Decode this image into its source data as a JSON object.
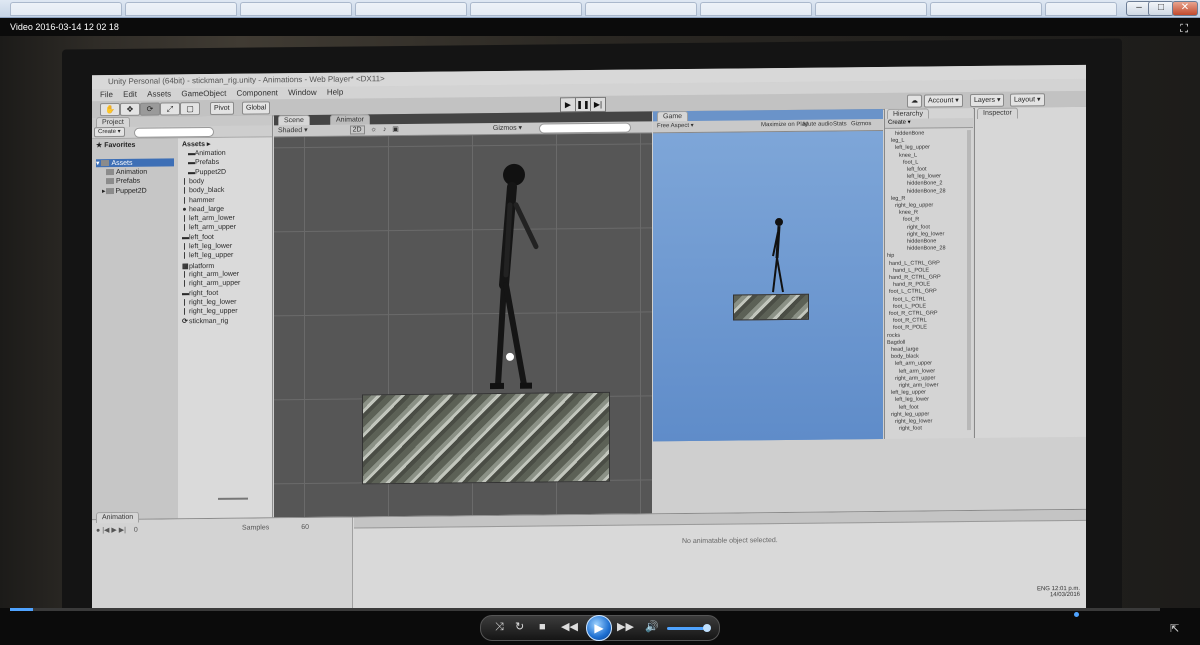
{
  "player": {
    "title": "Video 2016-03-14 12 02 18",
    "fullscreen_icon": "fullscreen-icon",
    "progress_fraction": 0.02,
    "volume_fraction": 0.85
  },
  "unity": {
    "window_title": "Unity Personal (64bit) - stickman_rig.unity - Animations - Web Player* <DX11>",
    "menu": [
      "File",
      "Edit",
      "Assets",
      "GameObject",
      "Component",
      "Window",
      "Help"
    ],
    "pivot_label": "Pivot",
    "global_label": "Global",
    "account_label": "Account",
    "layers_label": "Layers",
    "layout_label": "Layout",
    "tabs": {
      "project": "Project",
      "scene": "Scene",
      "animator": "Animator",
      "game": "Game",
      "hierarchy": "Hierarchy",
      "inspector": "Inspector",
      "animation": "Animation"
    },
    "project": {
      "create_label": "Create",
      "favorites_label": "Favorites",
      "assets_header": "Assets",
      "left_tree": [
        {
          "label": "Assets",
          "depth": 0
        },
        {
          "label": "Animation",
          "depth": 1
        },
        {
          "label": "Prefabs",
          "depth": 1
        },
        {
          "label": "Puppet2D",
          "depth": 1
        }
      ],
      "asset_items": [
        "Animation",
        "Prefabs",
        "Puppet2D",
        "body",
        "body_black",
        "hammer",
        "head_large",
        "left_arm_lower",
        "left_arm_upper",
        "left_foot",
        "left_leg_lower",
        "left_leg_upper",
        "platform",
        "right_arm_lower",
        "right_arm_upper",
        "right_foot",
        "right_leg_lower",
        "right_leg_upper",
        "stickman_rig"
      ]
    },
    "scene": {
      "shaded_label": "Shaded",
      "mode_2d": "2D",
      "gizmos_label": "Gizmos"
    },
    "game": {
      "aspect_label": "Free Aspect",
      "maximize_label": "Maximize on Play",
      "mute_label": "Mute audio",
      "stats_label": "Stats",
      "gizmos_label": "Gizmos"
    },
    "hierarchy": {
      "create_label": "Create",
      "items": [
        "hiddenBone",
        "leg_L",
        "left_leg_upper",
        "knee_L",
        "foot_L",
        "left_foot",
        "left_leg_lower",
        "hiddenBone_2",
        "hiddenBone_28",
        "leg_R",
        "right_leg_upper",
        "knee_R",
        "foot_R",
        "right_foot",
        "right_leg_lower",
        "hiddenBone",
        "hiddenBone_28",
        "hip",
        "hand_L_CTRL_GRP",
        "hand_L_POLE",
        "hand_R_CTRL_GRP",
        "hand_R_POLE",
        "foot_L_CTRL_GRP",
        "foot_L_CTRL",
        "foot_L_POLE",
        "foot_R_CTRL_GRP",
        "foot_R_CTRL",
        "foot_R_POLE",
        "rocks",
        "Bagdoll",
        "head_large",
        "body_black",
        "left_arm_upper",
        "left_arm_lower",
        "right_arm_upper",
        "right_arm_lower",
        "left_leg_upper",
        "left_leg_lower",
        "left_foot",
        "right_leg_upper",
        "right_leg_lower",
        "right_foot"
      ]
    },
    "animation": {
      "samples_label": "Samples",
      "samples_value": "60",
      "frame_value": "0",
      "empty_message": "No animatable object selected."
    },
    "clock": {
      "time": "12:01 p.m.",
      "date": "14/03/2016",
      "lang": "ENG"
    }
  }
}
